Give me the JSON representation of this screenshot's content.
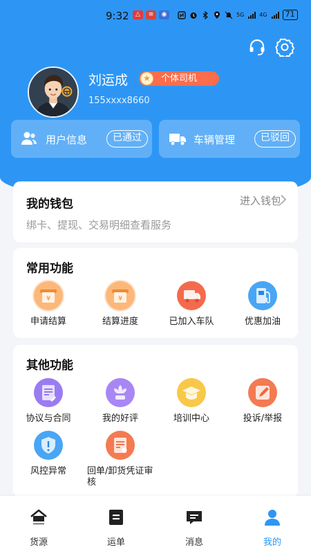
{
  "status_bar": {
    "time": "9:32",
    "signal_5g": "5G",
    "signal_4g": "4G",
    "battery": "71"
  },
  "header": {
    "service_icon": "headset-icon",
    "settings_icon": "gear-icon"
  },
  "profile": {
    "name": "刘运成",
    "role": "个体司机",
    "phone": "155xxxx8660"
  },
  "status_cards": [
    {
      "label": "用户信息",
      "status": "已通过",
      "icon": "users-icon"
    },
    {
      "label": "车辆管理",
      "status": "已驳回",
      "icon": "truck-icon"
    }
  ],
  "wallet": {
    "title": "我的钱包",
    "link": "进入钱包",
    "desc": "绑卡、提现、交易明细查看服务"
  },
  "common_functions": {
    "title": "常用功能",
    "items": [
      {
        "label": "申请结算",
        "icon": "settlement-apply-icon"
      },
      {
        "label": "结算进度",
        "icon": "settlement-progress-icon"
      },
      {
        "label": "已加入车队",
        "icon": "fleet-truck-icon"
      },
      {
        "label": "优惠加油",
        "icon": "fuel-pump-icon"
      }
    ]
  },
  "other_functions": {
    "title": "其他功能",
    "items": [
      {
        "label": "协议与合同",
        "icon": "contract-icon"
      },
      {
        "label": "我的好评",
        "icon": "flower-icon"
      },
      {
        "label": "培训中心",
        "icon": "graduation-cap-icon"
      },
      {
        "label": "投诉/举报",
        "icon": "pen-report-icon"
      },
      {
        "label": "风控异常",
        "icon": "shield-alert-icon"
      },
      {
        "label": "回单/卸货凭证审核",
        "icon": "receipt-review-icon"
      }
    ]
  },
  "bottom_nav": {
    "active": "我的",
    "items": [
      {
        "label": "货源",
        "icon": "home-icon"
      },
      {
        "label": "运单",
        "icon": "waybill-icon"
      },
      {
        "label": "消息",
        "icon": "message-icon"
      },
      {
        "label": "我的",
        "icon": "profile-icon"
      }
    ]
  },
  "colors": {
    "primary": "#2d96f5",
    "badge": "#fb6d4c",
    "background": "#f3f5f8"
  }
}
